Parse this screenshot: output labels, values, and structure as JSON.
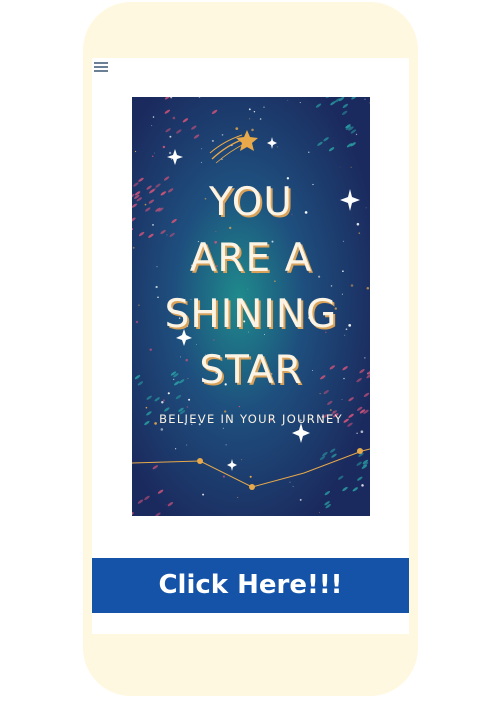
{
  "menu": {
    "icon": "hamburger-menu-icon"
  },
  "cover": {
    "title_lines": [
      "YOU",
      "ARE A",
      "SHINING",
      "STAR"
    ],
    "subtitle": "BELIEVE IN YOUR JOURNEY",
    "colors": {
      "background": "#1b2a5e",
      "accent_teal": "#1f8a8c",
      "lettering": "#fbf3e4",
      "gold": "#e8a94a",
      "pink": "#d8547a"
    }
  },
  "cta": {
    "label": "Click Here!!!",
    "color": "#1453a8"
  },
  "frame": {
    "device_color": "#fff8e0"
  }
}
